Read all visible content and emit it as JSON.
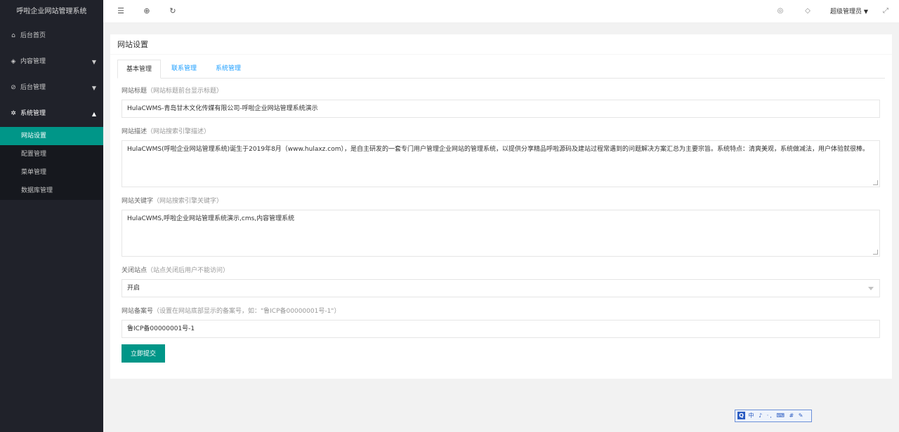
{
  "sidebar": {
    "logo": "呼啦企业网站管理系统",
    "items": [
      {
        "label": "后台首页",
        "icon": "home-icon"
      },
      {
        "label": "内容管理",
        "icon": "layers-icon"
      },
      {
        "label": "后台管理",
        "icon": "shield-icon"
      },
      {
        "label": "系统管理",
        "icon": "gear-icon"
      }
    ],
    "sub_items": [
      "网站设置",
      "配置管理",
      "菜单管理",
      "数据库管理"
    ],
    "active_sub": "网站设置"
  },
  "topbar": {
    "icons": [
      "menu-fold-icon",
      "globe-icon",
      "refresh-icon",
      "theme-icon",
      "tag-icon",
      "fullscreen-icon"
    ],
    "user": "超级管理员"
  },
  "card": {
    "title": "网站设置",
    "tabs": [
      "基本管理",
      "联系管理",
      "系统管理"
    ]
  },
  "form": {
    "site_title": {
      "label": "网站标题",
      "hint": "（网站标题前台显示标题）",
      "value": "HulaCWMS-青岛甘木文化传媒有限公司-呼啦企业网站管理系统演示"
    },
    "site_desc": {
      "label": "网站描述",
      "hint": "（网站搜索引擎描述）",
      "value": "HulaCWMS(呼啦企业网站管理系统)诞生于2019年8月（www.hulaxz.com），是自主研发的一套专门用户管理企业网站的管理系统，以提供分享精品呼啦源码及建站过程常遇到的问题解决方案汇总为主要宗旨。系统特点：清爽美观，系统做减法，用户体验就很棒。"
    },
    "site_keywords": {
      "label": "网站关键字",
      "hint": "（网站搜索引擎关键字）",
      "value": "HulaCWMS,呼啦企业网站管理系统演示,cms,内容管理系统"
    },
    "site_close": {
      "label": "关闭站点",
      "hint": "（站点关闭后用户不能访问）",
      "value": "开启"
    },
    "site_icp": {
      "label": "网站备案号",
      "hint": "（设置在网站底部显示的备案号，如：\"鲁ICP备00000001号-1\"）",
      "value": "鲁ICP备00000001号-1"
    },
    "submit_label": "立即提交"
  },
  "ime": {
    "label": "中 ♪ ·, ⌨ # ✎"
  }
}
